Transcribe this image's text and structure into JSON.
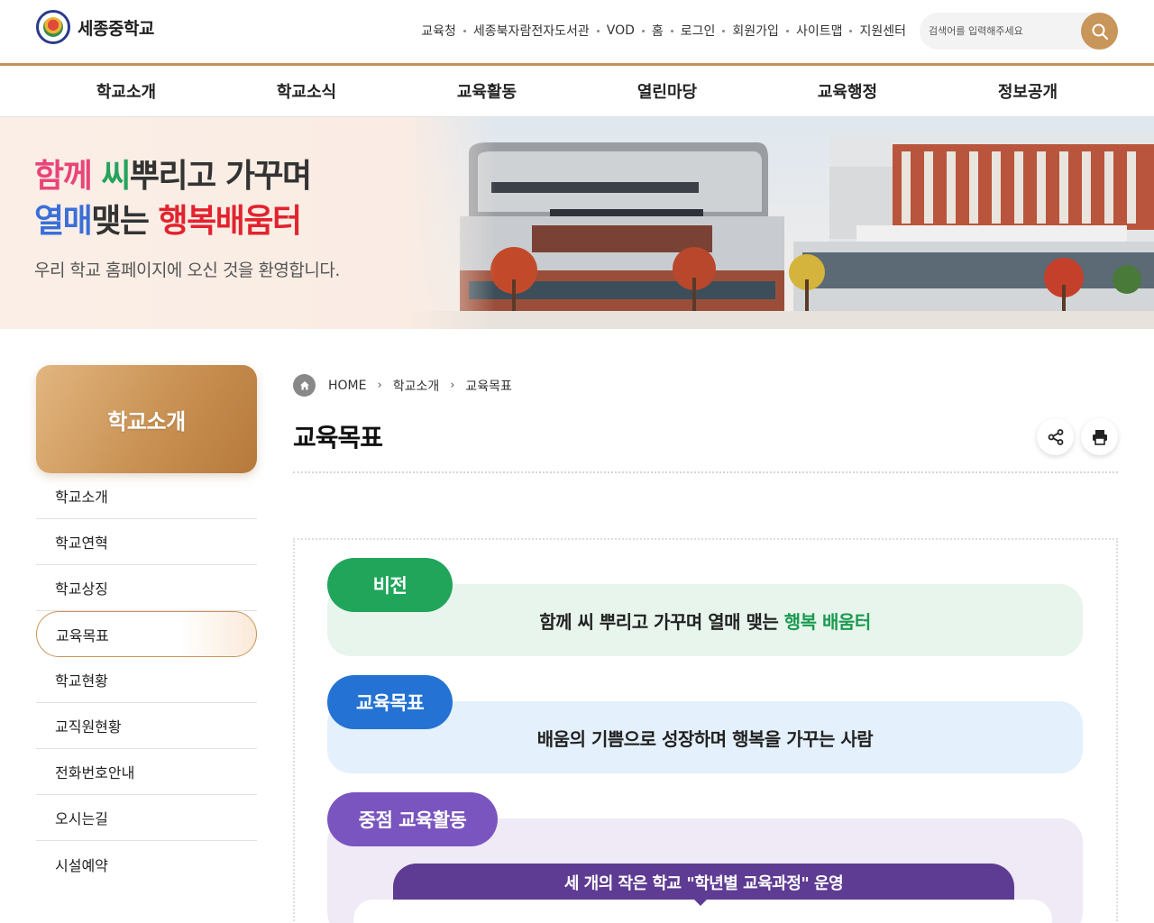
{
  "site": {
    "school_name": "세종중학교"
  },
  "util_links": [
    "교육청",
    "세종북자람전자도서관",
    "VOD",
    "홈",
    "로그인",
    "회원가입",
    "사이트맵",
    "지원센터"
  ],
  "search": {
    "placeholder": "검색어를 입력해주세요"
  },
  "gnb": [
    "학교소개",
    "학교소식",
    "교육활동",
    "열린마당",
    "교육행정",
    "정보공개"
  ],
  "hero": {
    "line1_a": "함께",
    "line1_b": "씨",
    "line1_c": "뿌리고 가꾸며",
    "line2_a": "열매",
    "line2_b": "맺는",
    "line2_c": "행복배움터",
    "subtitle": "우리 학교 홈페이지에 오신 것을 환영합니다."
  },
  "lnb": {
    "title": "학교소개",
    "items": [
      "학교소개",
      "학교연혁",
      "학교상징",
      "교육목표",
      "학교현황",
      "교직원현황",
      "전화번호안내",
      "오시는길",
      "시설예약"
    ],
    "active_index": 3
  },
  "breadcrumb": {
    "home": "HOME",
    "level1": "학교소개",
    "level2": "교육목표"
  },
  "page": {
    "title": "교육목표"
  },
  "goals": {
    "vision": {
      "label": "비전",
      "text_plain": "함께 씨 뿌리고 가꾸며 열매 맺는",
      "text_highlight": "행복 배움터"
    },
    "goal": {
      "label": "교육목표",
      "text": "배움의 기쁨으로 성장하며 행복을 가꾸는 사람"
    },
    "focus": {
      "label": "중점 교육활동",
      "sub_title": "세 개의 작은 학교 \"학년별 교육과정\" 운영"
    }
  },
  "colors": {
    "accent": "#c8955a",
    "vision_green": "#20a55b",
    "goal_blue": "#2472d4",
    "focus_purple": "#7a55bf"
  }
}
